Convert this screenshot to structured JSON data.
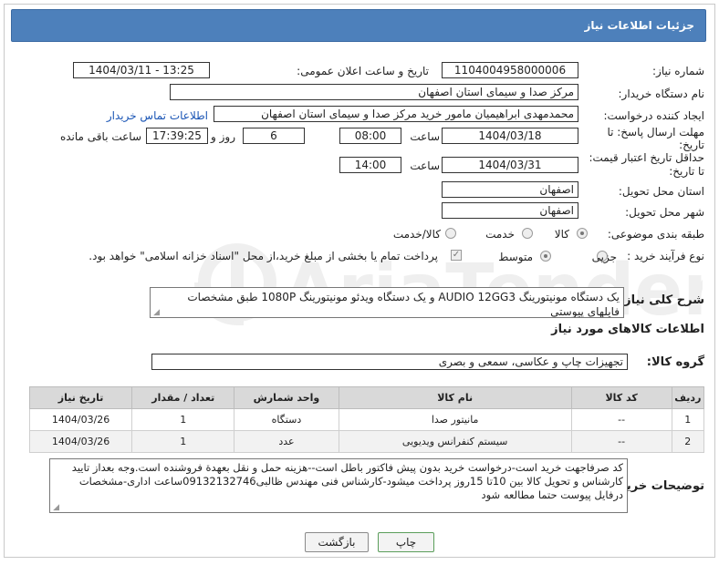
{
  "header": {
    "title": "جزئیات اطلاعات نیاز"
  },
  "fields": {
    "need_number_label": "شماره نیاز:",
    "need_number": "1104004958000006",
    "announce_label": "تاریخ و ساعت اعلان عمومی:",
    "announce_value": "1404/03/11 - 13:25",
    "buyer_org_label": "نام دستگاه خریدار:",
    "buyer_org": "مرکز صدا و سیمای استان اصفهان",
    "creator_label": "ایجاد کننده درخواست:",
    "creator": "محمدمهدی ابراهیمیان مامور خرید مرکز صدا و سیمای استان اصفهان",
    "contact_link": "اطلاعات تماس خریدار",
    "reply_deadline_label_1": "مهلت ارسال پاسخ: تا",
    "reply_deadline_label_2": "تاریخ:",
    "reply_date": "1404/03/18",
    "time_label": "ساعت",
    "reply_time": "08:00",
    "days_value": "6",
    "days_label": "روز و",
    "remaining_time": "17:39:25",
    "remaining_label": "ساعت باقی مانده",
    "price_validity_label_1": "حداقل تاریخ اعتبار قیمت:",
    "price_validity_label_2": "تا تاریخ:",
    "validity_date": "1404/03/31",
    "validity_time": "14:00",
    "delivery_province_label": "استان محل تحویل:",
    "delivery_province": "اصفهان",
    "delivery_city_label": "شهر محل تحویل:",
    "delivery_city": "اصفهان",
    "category_label": "طبقه بندی موضوعی:",
    "category_options": [
      "کالا",
      "خدمت",
      "کالا/خدمت"
    ],
    "process_label": "نوع فرآیند خرید :",
    "process_options": [
      "جزیی",
      "متوسط"
    ],
    "payment_note": "پرداخت تمام یا بخشی از مبلغ خرید،از محل \"اسناد خزانه اسلامی\" خواهد بود."
  },
  "description": {
    "label": "شرح کلی نیاز:",
    "text": "یک دستگاه مونیتورینگ AUDIO 12GG3 و یک دستگاه ویدئو مونیتورینگ 1080P طبق مشخصات فایلهای پیوستی"
  },
  "goods": {
    "section_title": "اطلاعات کالاهای مورد نیاز",
    "group_label": "گروه کالا:",
    "group_value": "تجهیزات چاپ و عکاسی، سمعی و بصری",
    "columns": [
      "ردیف",
      "کد کالا",
      "نام کالا",
      "واحد شمارش",
      "تعداد / مقدار",
      "تاریخ نیاز"
    ],
    "rows": [
      {
        "row": "1",
        "code": "--",
        "name": "مانیتور صدا",
        "unit": "دستگاه",
        "qty": "1",
        "date": "1404/03/26"
      },
      {
        "row": "2",
        "code": "--",
        "name": "سیستم کنفرانس ویدیویی",
        "unit": "عدد",
        "qty": "1",
        "date": "1404/03/26"
      }
    ]
  },
  "buyer_notes": {
    "label": "توضیحات خریدار:",
    "text": "کد صرفاجهت خرید است-درخواست خرید بدون پیش فاکتور باطل است--هزینه حمل و نقل بعهدة فروشنده است.وجه بعداز تایید  کارشناس و تحویل کالا بین 10تا 15روز پرداخت میشود-کارشناس فنی مهندس ظالبی09132132746ساعت اداری-مشخصات درفایل پیوست حتما مطالعه شود"
  },
  "buttons": {
    "print": "چاپ",
    "back": "بازگشت"
  },
  "watermark": {
    "text": "AriaTender.neT"
  },
  "colors": {
    "header_bg": "#4d80bb",
    "link": "#1a55b5"
  }
}
